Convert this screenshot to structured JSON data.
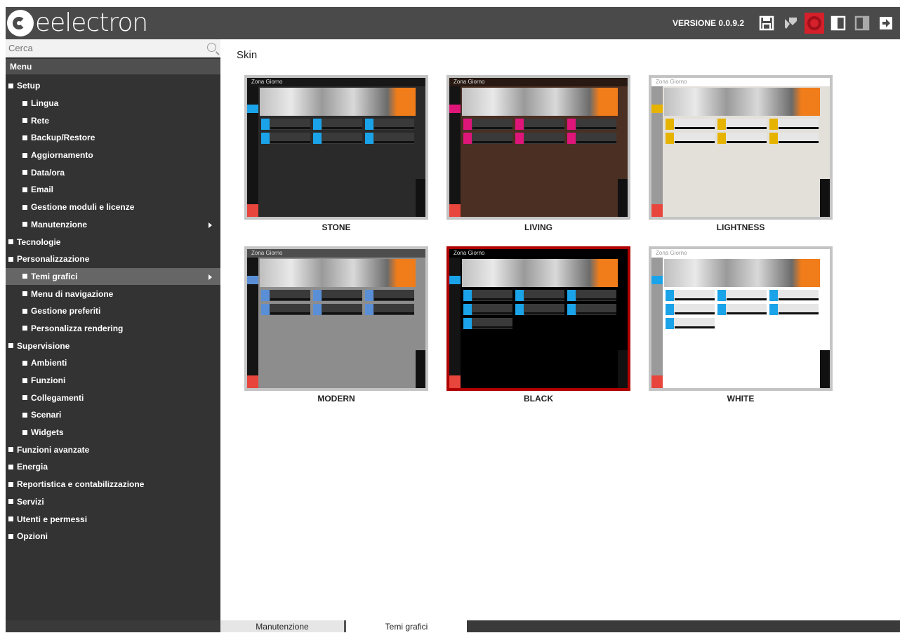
{
  "header": {
    "logo_text": "eelectron",
    "version": "VERSIONE 0.0.9.2",
    "toolbar_icons": [
      "save-icon",
      "wrench-icon",
      "lifebuoy-icon",
      "panel-left-icon",
      "panel-right-icon",
      "exit-icon",
      "logout-icon"
    ]
  },
  "sidebar": {
    "search_placeholder": "Cerca",
    "menu_title": "Menu",
    "items": [
      {
        "label": "Setup",
        "level": 0
      },
      {
        "label": "Lingua",
        "level": 1
      },
      {
        "label": "Rete",
        "level": 1
      },
      {
        "label": "Backup/Restore",
        "level": 1
      },
      {
        "label": "Aggiornamento",
        "level": 1
      },
      {
        "label": "Data/ora",
        "level": 1
      },
      {
        "label": "Email",
        "level": 1
      },
      {
        "label": "Gestione moduli e licenze",
        "level": 1
      },
      {
        "label": "Manutenzione",
        "level": 1,
        "submenu": true
      },
      {
        "label": "Tecnologie",
        "level": 0
      },
      {
        "label": "Personalizzazione",
        "level": 0
      },
      {
        "label": "Temi grafici",
        "level": 1,
        "submenu": true,
        "active": true
      },
      {
        "label": "Menu di navigazione",
        "level": 1
      },
      {
        "label": "Gestione preferiti",
        "level": 1
      },
      {
        "label": "Personalizza rendering",
        "level": 1
      },
      {
        "label": "Supervisione",
        "level": 0
      },
      {
        "label": "Ambienti",
        "level": 1
      },
      {
        "label": "Funzioni",
        "level": 1
      },
      {
        "label": "Collegamenti",
        "level": 1
      },
      {
        "label": "Scenari",
        "level": 1
      },
      {
        "label": "Widgets",
        "level": 1
      },
      {
        "label": "Funzioni avanzate",
        "level": 0
      },
      {
        "label": "Energia",
        "level": 0
      },
      {
        "label": "Reportistica e contabilizzazione",
        "level": 0
      },
      {
        "label": "Servizi",
        "level": 0
      },
      {
        "label": "Utenti e permessi",
        "level": 0
      },
      {
        "label": "Opzioni",
        "level": 0
      }
    ]
  },
  "main": {
    "title": "Skin",
    "skins": [
      {
        "name": "STONE",
        "zone": "Zona Giorno",
        "bg": "#2a2a2a",
        "accent": "#1aa3e8",
        "selected": false
      },
      {
        "name": "LIVING",
        "zone": "Zona Giorno",
        "bg": "#4a2f22",
        "accent": "#e0157a",
        "selected": false
      },
      {
        "name": "LIGHTNESS",
        "zone": "Zona Giorno",
        "bg": "#e3e0da",
        "accent": "#e6b300",
        "selected": false
      },
      {
        "name": "MODERN",
        "zone": "Zona Giorno",
        "bg": "#8d8d8d",
        "accent": "#5a8fd6",
        "selected": false
      },
      {
        "name": "BLACK",
        "zone": "Zona Giorno",
        "bg": "#000000",
        "accent": "#1aa3e8",
        "selected": true
      },
      {
        "name": "WHITE",
        "zone": "Zona Giorno",
        "bg": "#ffffff",
        "accent": "#1aa3e8",
        "selected": false
      }
    ]
  },
  "footer_tabs": [
    "Manutenzione",
    "Temi grafici"
  ]
}
